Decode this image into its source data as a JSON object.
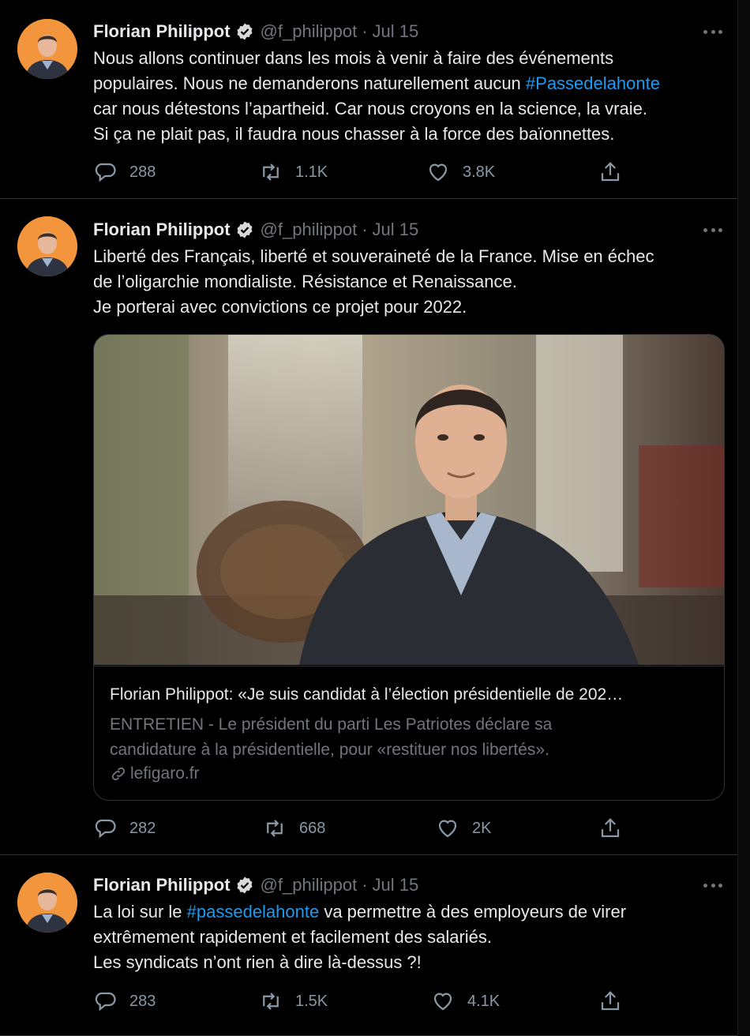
{
  "tweets": [
    {
      "author_name": "Florian Philippot",
      "handle": "@f_philippot",
      "separator": "·",
      "date": "Jul 15",
      "lines": [
        {
          "before": "Nous allons continuer dans les mois à venir à faire des événements",
          "hashtag": "",
          "after": ""
        },
        {
          "before": "populaires. Nous ne demanderons naturellement aucun ",
          "hashtag": "#Passedelahonte",
          "after": ""
        },
        {
          "before": "car nous détestons l’apartheid. Car nous croyons en la science, la vraie.",
          "hashtag": "",
          "after": ""
        },
        {
          "before": "Si ça ne plait pas, il faudra nous chasser à la force des baïonnettes.",
          "hashtag": "",
          "after": ""
        }
      ],
      "replies": "288",
      "retweets": "1.1K",
      "likes": "3.8K"
    },
    {
      "author_name": "Florian Philippot",
      "handle": "@f_philippot",
      "separator": "·",
      "date": "Jul 15",
      "lines": [
        {
          "before": "Liberté des Français, liberté  et souveraineté de la France. Mise en échec",
          "hashtag": "",
          "after": ""
        },
        {
          "before": "de l’oligarchie mondialiste. Résistance et Renaissance.",
          "hashtag": "",
          "after": ""
        },
        {
          "before": "Je porterai avec convictions ce projet pour 2022.",
          "hashtag": "",
          "after": ""
        }
      ],
      "card": {
        "title": "Florian Philippot: «Je suis candidat à l’élection présidentielle de 202…",
        "description_lines": [
          "ENTRETIEN - Le président du parti Les Patriotes déclare sa",
          "candidature à la présidentielle, pour «restituer nos libertés»."
        ],
        "domain": "lefigaro.fr"
      },
      "replies": "282",
      "retweets": "668",
      "likes": "2K"
    },
    {
      "author_name": "Florian Philippot",
      "handle": "@f_philippot",
      "separator": "·",
      "date": "Jul 15",
      "lines": [
        {
          "before": "La loi sur le ",
          "hashtag": "#passedelahonte",
          "after": " va permettre à des employeurs de virer"
        },
        {
          "before": "extrêmement rapidement et facilement des salariés.",
          "hashtag": "",
          "after": ""
        },
        {
          "before": "Les syndicats n’ont rien à dire là-dessus ?!",
          "hashtag": "",
          "after": ""
        }
      ],
      "replies": "283",
      "retweets": "1.5K",
      "likes": "4.1K"
    }
  ],
  "icons": {
    "reply": "reply-icon",
    "retweet": "retweet-icon",
    "like": "like-icon",
    "share": "share-icon",
    "more": "more-icon",
    "verified": "verified-badge-icon",
    "link": "link-icon"
  },
  "colors": {
    "background": "#000000",
    "text": "#e7e9ea",
    "muted": "#71767b",
    "hashtag": "#1d9bf0",
    "verified_badge": "#d9d9d9",
    "avatar_background": "#f2953c"
  }
}
